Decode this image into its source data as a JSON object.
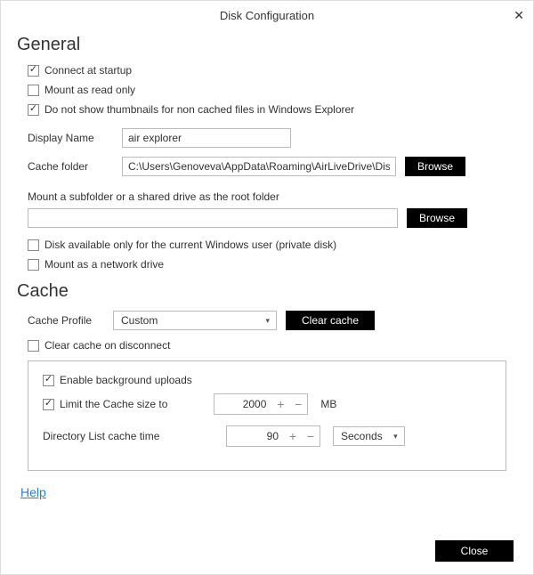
{
  "window": {
    "title": "Disk Configuration",
    "close_label": "✕"
  },
  "general": {
    "heading": "General",
    "connect_startup": "Connect at startup",
    "mount_readonly": "Mount as read only",
    "no_thumbnails": "Do not show thumbnails for non cached files in Windows Explorer",
    "display_name_label": "Display Name",
    "display_name_value": "air explorer",
    "cache_folder_label": "Cache folder",
    "cache_folder_value": "C:\\Users\\Genoveva\\AppData\\Roaming\\AirLiveDrive\\DisksCa",
    "browse": "Browse",
    "subfolder_label": "Mount a subfolder or a shared drive as the root folder",
    "subfolder_value": "",
    "private_disk": "Disk available only for the current Windows user (private disk)",
    "network_drive": "Mount as a network drive"
  },
  "cache": {
    "heading": "Cache",
    "profile_label": "Cache Profile",
    "profile_value": "Custom",
    "clear_cache": "Clear cache",
    "clear_on_disconnect": "Clear cache on disconnect",
    "enable_bg_uploads": "Enable background uploads",
    "limit_size_label": "Limit the Cache size to",
    "limit_size_value": "2000",
    "mb": "MB",
    "dir_time_label": "Directory List cache time",
    "dir_time_value": "90",
    "dir_time_unit": "Seconds"
  },
  "footer": {
    "help": "Help",
    "close": "Close"
  }
}
